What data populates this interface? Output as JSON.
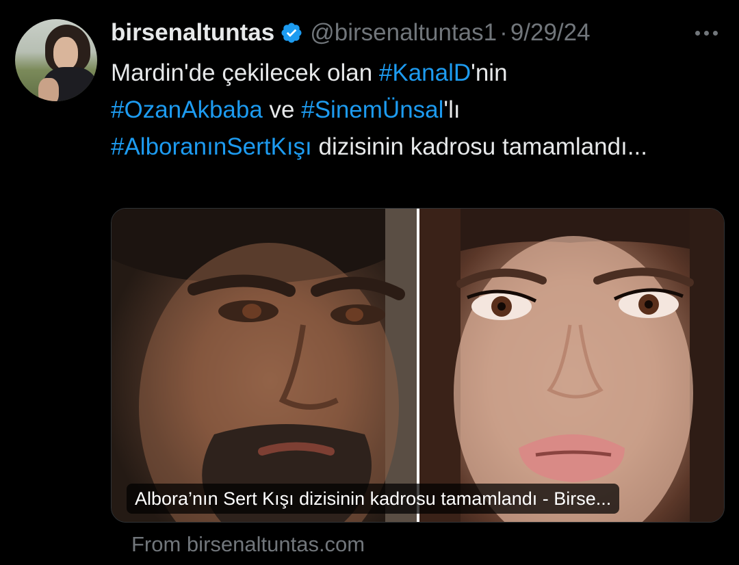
{
  "tweet": {
    "display_name": "birsenaltuntas",
    "verified_icon": "verified-badge-icon",
    "handle": "@birsenaltuntas1",
    "separator": "·",
    "date": "9/29/24",
    "body": {
      "t1": "Mardin'de çekilecek olan ",
      "tag1": "#KanalD",
      "t2": "'nin ",
      "tag2": "#OzanAkbaba",
      "t3": " ve ",
      "tag3": "#SinemÜnsal",
      "t4": "'lı ",
      "tag4": "#AlboranınSertKışı",
      "t5": " dizisinin kadrosu tamamlandı..."
    },
    "link_card": {
      "caption": "Albora’nın Sert Kışı dizisinin kadrosu tamamlandı - Birse...",
      "source": "From birsenaltuntas.com"
    }
  },
  "colors": {
    "background": "#000000",
    "text": "#e7e9ea",
    "muted": "#71767b",
    "accent": "#1d9bf0"
  }
}
